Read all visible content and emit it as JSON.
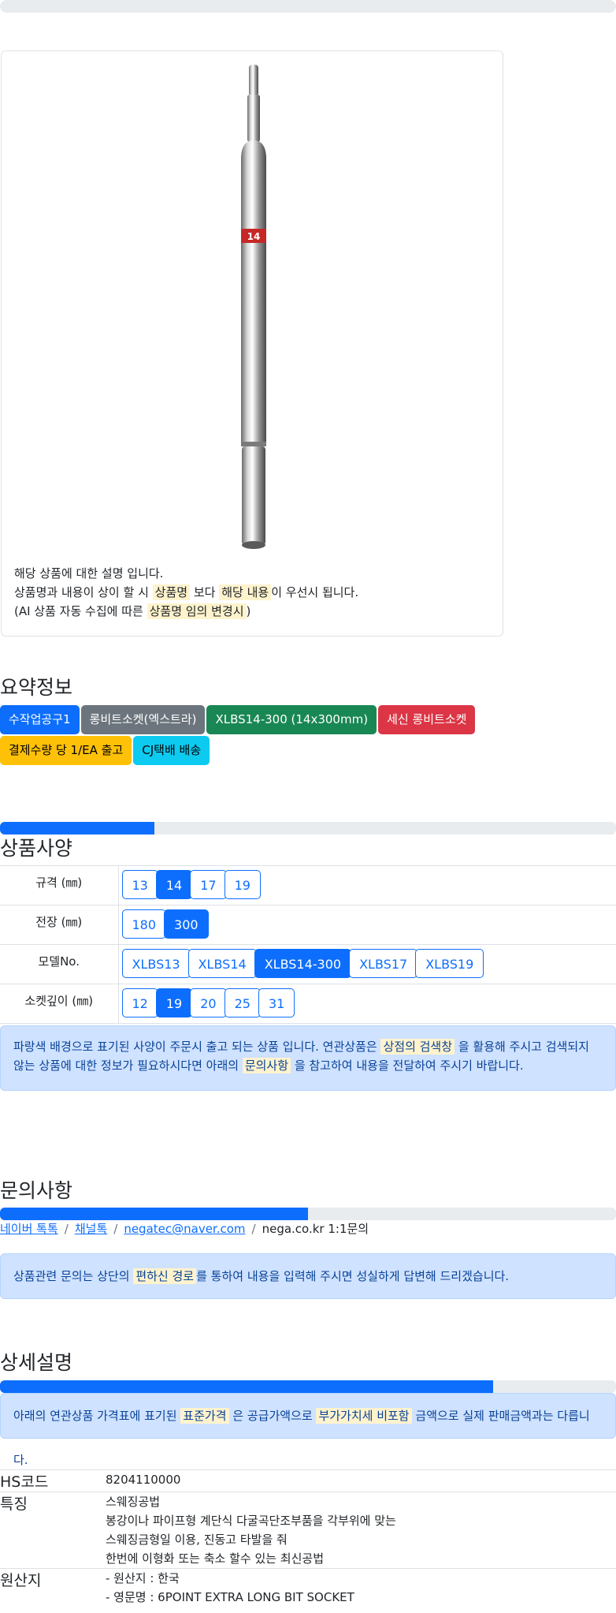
{
  "image": {
    "note_line1": "해당 상품에 대한 설명 입니다.",
    "note_line2_a": "상품명과 내용이 상이 할 시",
    "note_line2_hl1": "상품명",
    "note_line2_b": "보다",
    "note_line2_hl2": "해당 내용",
    "note_line2_c": "이 우선시 됩니다.",
    "note_line3_a": "(AI 상품 자동 수집에 따른",
    "note_line3_hl": "상품명 임의 변경시",
    "note_line3_b": ")",
    "size_mark": "14"
  },
  "summary": {
    "title": "요약정보",
    "badges": [
      {
        "label": "수작업공구1",
        "color": "#0d6efd"
      },
      {
        "label": "롱비트소켓(엑스트라)",
        "color": "#6c757d"
      },
      {
        "label": "XLBS14-300 (14x300mm)",
        "color": "#198754"
      },
      {
        "label": "세신 롱비트소켓",
        "color": "#dc3545"
      },
      {
        "label": "결제수량 당 1/EA 출고",
        "color": "#ffc107"
      },
      {
        "label": "CJ택배 배송",
        "color": "#0dcaf0"
      }
    ]
  },
  "spec": {
    "title": "상품사양",
    "progress": 0.25,
    "rows": [
      {
        "label": "규격 (㎜)",
        "options": [
          "13",
          "14",
          "17",
          "19"
        ],
        "selected": "14"
      },
      {
        "label": "전장 (㎜)",
        "options": [
          "180",
          "300"
        ],
        "selected": "300"
      },
      {
        "label": "모델No.",
        "options": [
          "XLBS13",
          "XLBS14",
          "XLBS14-300",
          "XLBS17",
          "XLBS19"
        ],
        "selected": "XLBS14-300"
      },
      {
        "label": "소켓깊이 (㎜)",
        "options": [
          "12",
          "19",
          "20",
          "25",
          "31"
        ],
        "selected": "19"
      }
    ],
    "alert_a": "파랑색 배경으로 표기된 사양이 주문시 출고 되는 상품 입니다. 연관상품은",
    "alert_hl1": "상점의 검색창",
    "alert_b": "을 활용해 주시고 검색되지 않는 상품에 대한 정보가 필요하시다면 아래의",
    "alert_hl2": "문의사항",
    "alert_c": "을 참고하여 내용을 전달하여 주시기 바랍니다."
  },
  "inquiry": {
    "title": "문의사항",
    "progress": 0.5,
    "links": [
      "네이버 톡톡",
      "채널톡",
      "negatec@naver.com"
    ],
    "last": "nega.co.kr 1:1문의",
    "alert_a": "상품관련 문의는 상단의",
    "alert_hl": "편하신 경로",
    "alert_b": "를 통하여 내용을 입력해 주시면 성실하게 답변해 드리겠습니다."
  },
  "detail": {
    "title": "상세설명",
    "progress": 0.8,
    "alert_a": "아래의 연관상품 가격표에 표기된",
    "alert_hl1": "표준가격",
    "alert_b": "은 공급가액으로",
    "alert_hl2": "부가가치세 비포함",
    "alert_c": "금액으로 실제 판매금액과는 다릅니다.",
    "info": [
      {
        "key": "HS코드",
        "lines": [
          "8204110000"
        ]
      },
      {
        "key": "특징",
        "lines": [
          "스웨징공법",
          "봉강이나 파이프형 계단식 다굴곡단조부품을 각부위에 맞는",
          "스웨징금형일 이용, 진동고 타발을 줘",
          "한번에 이형화 또는 축소 할수 있는 최신공법"
        ]
      },
      {
        "key": "원산지",
        "lines": [
          "- 원산지 : 한국",
          "- 영문명 : 6POINT EXTRA LONG BIT SOCKET"
        ]
      }
    ]
  }
}
